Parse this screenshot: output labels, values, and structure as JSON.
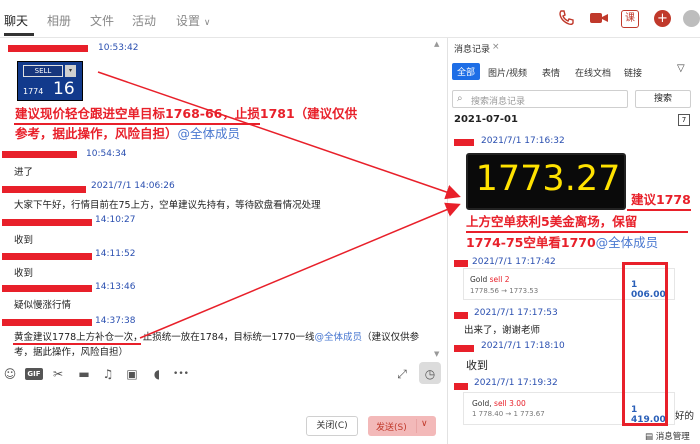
{
  "nav": {
    "tabs": [
      "聊天",
      "相册",
      "文件",
      "活动",
      "设置"
    ],
    "settings_chevron": "∨",
    "icons": [
      "phone-icon",
      "video-icon",
      "lesson-icon",
      "add-icon",
      "avatar"
    ],
    "lesson_label": "课",
    "add_label": "+"
  },
  "chat": {
    "messages": [
      {
        "time": "10:53:42"
      },
      {
        "widget": {
          "button": "SELL",
          "price_small": "1774",
          "price_big": "16"
        }
      },
      {
        "text_line1": "建议现价轻仓跟进空单目标1768-66，止损1781（建议仅供",
        "text_line2": "参考，据此操作，风险自担）",
        "mention": "@全体成员"
      },
      {
        "time": "10:54:34",
        "text": "进了"
      },
      {
        "time": "2021/7/1 14:06:26",
        "text": "大家下午好，行情目前在75上方，空单建议先持有，等待欧盘看情况处理"
      },
      {
        "time": "14:10:27",
        "text": "收到"
      },
      {
        "time": "14:11:52",
        "text": "收到"
      },
      {
        "time": "14:13:46",
        "text": "疑似慢涨行情"
      },
      {
        "time": "14:37:38",
        "text_a": "黄金建议1778上方补仓一次，",
        "text_b": "止损统一放在1784，目标统一1770一线",
        "mention": "@全体成员",
        "text_c": "（建议仅供参",
        "text_line2": "考，据此操作，风险自担）"
      }
    ]
  },
  "toolbar": {
    "icons": [
      "emoji-icon",
      "gif-icon",
      "scissors-icon",
      "folder-icon",
      "music-icon",
      "image-icon",
      "more-icon",
      "expand-icon",
      "history-icon"
    ],
    "gif_label": "GIF",
    "more_label": "•••",
    "close_button": "关闭(C)",
    "send_button": "发送(S)",
    "send_chevron": "∨"
  },
  "history": {
    "title": "消息记录",
    "close": "×",
    "filters": [
      "全部",
      "图片/视频",
      "表情",
      "在线文档",
      "链接"
    ],
    "search_placeholder": "搜索消息记录",
    "search_button": "搜索",
    "date": "2021-07-01",
    "entries": [
      {
        "time": "2021/7/1 17:16:32"
      },
      {
        "price": "1773.27",
        "text_part1": "建议1778",
        "text_line2": "上方空单获利5美金离场，保留",
        "text_line3": "1774-75空单看1770",
        "mention": "@全体成员"
      },
      {
        "time": "2021/7/1 17:17:42",
        "card": {
          "symbol": "Gold",
          "side": "sell 2",
          "range": "1778.56 → 1773.53",
          "profit": "1 006.00"
        }
      },
      {
        "time": "2021/7/1 17:17:53",
        "text": "出来了，谢谢老师"
      },
      {
        "time": "2021/7/1 17:18:10",
        "text": "收到"
      },
      {
        "time": "2021/7/1 17:19:32",
        "card": {
          "symbol": "Gold,",
          "side": "sell 3.00",
          "range": "1 778.40 → 1 773.67",
          "profit": "1 419.00"
        },
        "text": "好的"
      }
    ],
    "footer": "消息管理"
  },
  "colors": {
    "accent_red": "#e8202a",
    "link_blue": "#2a4fb0",
    "filter_active": "#1e6ee6",
    "price_yellow": "#ffe200"
  }
}
